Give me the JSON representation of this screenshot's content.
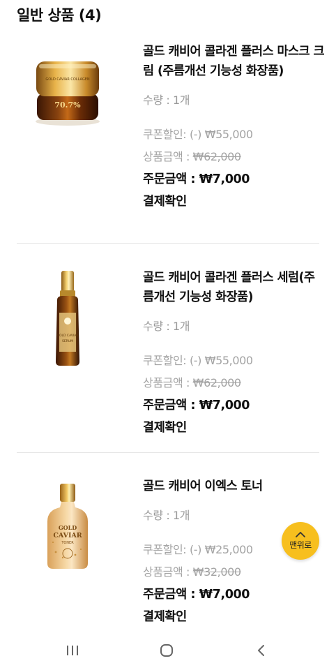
{
  "section": {
    "title": "일반 상품 (4)"
  },
  "products": [
    {
      "name": "골드 캐비어 콜라겐 플러스 마스크 크림 (주름개선 기능성 화장품)",
      "quantity": "수량 : 1개",
      "coupon_label": "쿠폰할인: (-) ",
      "coupon_value": "₩55,000",
      "price_label": "상품금액 : ",
      "price_value": "₩62,000",
      "total": "주문금액 : ₩7,000",
      "confirm": "결제확인",
      "image_icon": "cream-jar-icon",
      "image_text": "70.7%"
    },
    {
      "name": "골드 캐비어 콜라겐 플러스 세럼(주름개선 기능성 화장품)",
      "quantity": "수량 : 1개",
      "coupon_label": "쿠폰할인: (-) ",
      "coupon_value": "₩55,000",
      "price_label": "상품금액 : ",
      "price_value": "₩62,000",
      "total": "주문금액 : ₩7,000",
      "confirm": "결제확인",
      "image_icon": "serum-bottle-icon"
    },
    {
      "name": "골드 캐비어 이엑스 토너",
      "quantity": "수량 : 1개",
      "coupon_label": "쿠폰할인: (-) ",
      "coupon_value": "₩25,000",
      "price_label": "상품금액 : ",
      "price_value": "₩32,000",
      "total": "주문금액 : ₩7,000",
      "confirm": "결제확인",
      "image_icon": "toner-bottle-icon",
      "image_text": [
        "GOLD",
        "CAVIAR",
        "TONER"
      ]
    }
  ],
  "scroll_top": {
    "label": "맨위로",
    "icon": "chevron-up-icon",
    "color": "#f7bf1e"
  },
  "navbar": {
    "recent_icon": "recent-apps-icon",
    "home_icon": "home-icon",
    "back_icon": "back-icon"
  }
}
